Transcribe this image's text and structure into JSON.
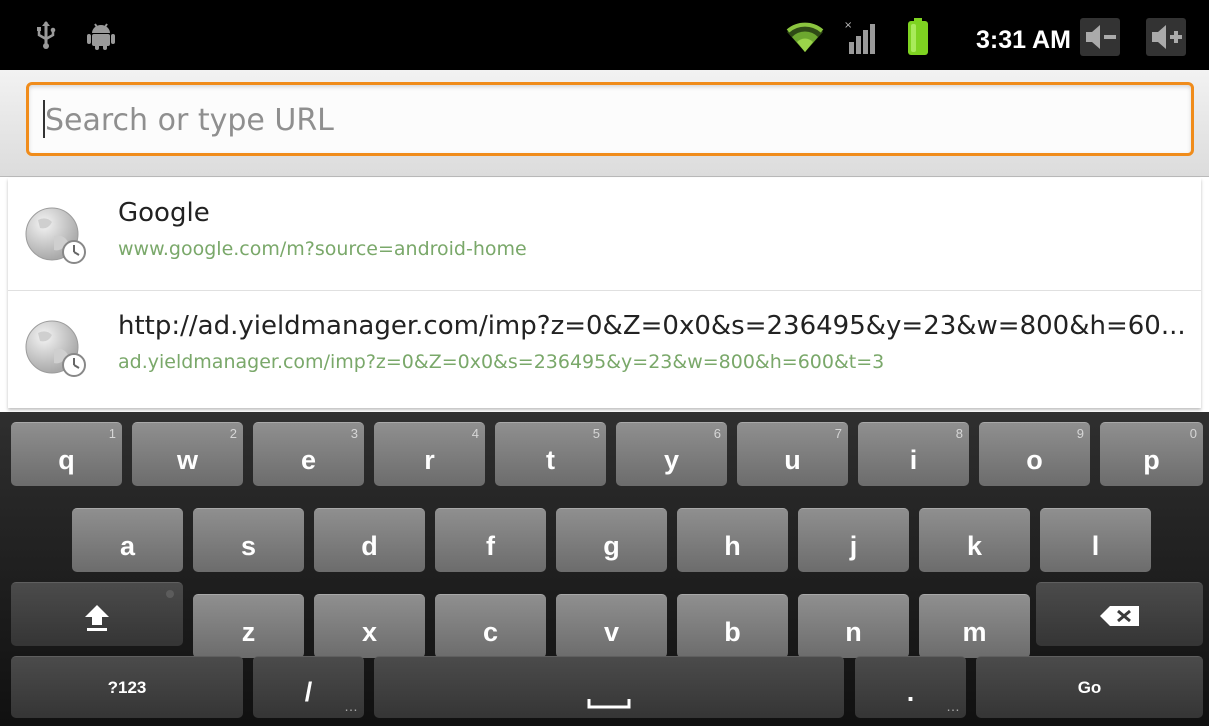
{
  "status_bar": {
    "time": "3:31 AM",
    "icons": [
      "usb-icon",
      "android-debug-icon",
      "wifi-icon",
      "signal-icon",
      "battery-icon",
      "volume-down-icon",
      "volume-up-icon"
    ],
    "colors": {
      "wifi": "#8bc53f",
      "battery": "#7ed321",
      "background": "#000000"
    }
  },
  "address_bar": {
    "placeholder": "Search or type URL",
    "value": "",
    "focus_color": "#f08c1b"
  },
  "suggestions": [
    {
      "title": "Google",
      "url": "www.google.com/m?source=android-home",
      "icon": "history-globe-icon"
    },
    {
      "title": "http://ad.yieldmanager.com/imp?z=0&Z=0x0&s=236495&y=23&w=800&h=60...",
      "url": "ad.yieldmanager.com/imp?z=0&Z=0x0&s=236495&y=23&w=800&h=600&t=3",
      "icon": "history-globe-icon"
    }
  ],
  "keyboard": {
    "row1": [
      {
        "label": "q",
        "num": "1"
      },
      {
        "label": "w",
        "num": "2"
      },
      {
        "label": "e",
        "num": "3"
      },
      {
        "label": "r",
        "num": "4"
      },
      {
        "label": "t",
        "num": "5"
      },
      {
        "label": "y",
        "num": "6"
      },
      {
        "label": "u",
        "num": "7"
      },
      {
        "label": "i",
        "num": "8"
      },
      {
        "label": "o",
        "num": "9"
      },
      {
        "label": "p",
        "num": "0"
      }
    ],
    "row2": [
      "a",
      "s",
      "d",
      "f",
      "g",
      "h",
      "j",
      "k",
      "l"
    ],
    "row3": [
      "z",
      "x",
      "c",
      "v",
      "b",
      "n",
      "m"
    ],
    "symbols_key": "?123",
    "slash_key": "/",
    "period_key": ".",
    "go_key": "Go",
    "key_color": "#7d7d7d",
    "dark_key_color": "#404040"
  }
}
